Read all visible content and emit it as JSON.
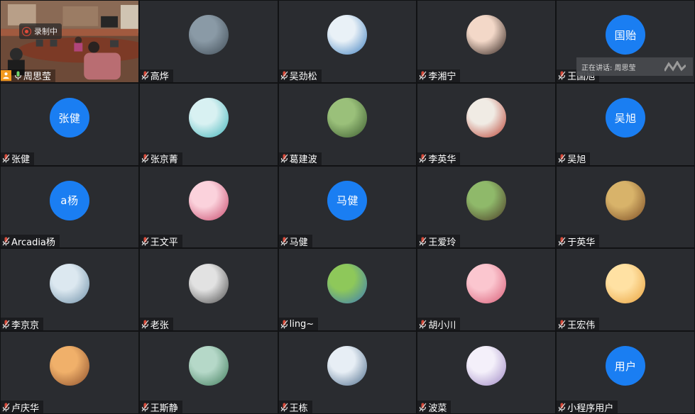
{
  "recording_label": "录制中",
  "speaking_banner": "正在讲话: 周思莹",
  "colors": {
    "accent": "#1a7ef2",
    "tile_bg": "#2a2c30",
    "mic": "#d64a3a",
    "host": "#f39a1e"
  },
  "participants": [
    {
      "name": "周思莹",
      "type": "video",
      "host": true
    },
    {
      "name": "高烨",
      "type": "photo",
      "icon": "foggy-figure-photo",
      "c1": "#8a9aa6",
      "c2": "#3f4b55"
    },
    {
      "name": "吴劲松",
      "type": "photo",
      "icon": "clouds-photo",
      "c1": "#e9f1f7",
      "c2": "#3d7fbf"
    },
    {
      "name": "李湘宁",
      "type": "photo",
      "icon": "portrait-photo",
      "c1": "#f3d8c8",
      "c2": "#2d1f1a"
    },
    {
      "name": "王国旭",
      "type": "text",
      "initials": "国贻"
    },
    {
      "name": "张健",
      "type": "text",
      "initials": "张健"
    },
    {
      "name": "张京菁",
      "type": "photo",
      "icon": "flower-photo",
      "c1": "#d8f1f2",
      "c2": "#3fb3b9"
    },
    {
      "name": "葛建波",
      "type": "photo",
      "icon": "garden-photo",
      "c1": "#9ac07a",
      "c2": "#3a5a2e"
    },
    {
      "name": "李英华",
      "type": "photo",
      "icon": "toys-photo",
      "c1": "#f0ebe4",
      "c2": "#b93e2f"
    },
    {
      "name": "吴旭",
      "type": "text",
      "initials": "吴旭"
    },
    {
      "name": "Arcadia杨",
      "type": "text",
      "initials": "a杨"
    },
    {
      "name": "王文平",
      "type": "photo",
      "icon": "blossom-photo",
      "c1": "#fbd2dc",
      "c2": "#c7466a"
    },
    {
      "name": "马健",
      "type": "text",
      "initials": "马健"
    },
    {
      "name": "王爱玲",
      "type": "photo",
      "icon": "tree-photo",
      "c1": "#8fb96a",
      "c2": "#4b3a26"
    },
    {
      "name": "于英华",
      "type": "photo",
      "icon": "cat-photo",
      "c1": "#d8b36a",
      "c2": "#7a4b23"
    },
    {
      "name": "李京京",
      "type": "photo",
      "icon": "ferris-wheel-photo",
      "c1": "#dce8f0",
      "c2": "#6c8ea6"
    },
    {
      "name": "老张",
      "type": "photo",
      "icon": "elder-portrait-photo",
      "c1": "#e2e2e2",
      "c2": "#4a4a4a"
    },
    {
      "name": "ling~",
      "type": "photo",
      "icon": "cartoon-house-photo",
      "c1": "#8ec85a",
      "c2": "#3a7ab9"
    },
    {
      "name": "胡小川",
      "type": "photo",
      "icon": "rose-photo",
      "c1": "#fbc6cf",
      "c2": "#d75a74"
    },
    {
      "name": "王宏伟",
      "type": "photo",
      "icon": "kitten-photo",
      "c1": "#ffe1a3",
      "c2": "#e8a03a"
    },
    {
      "name": "卢庆华",
      "type": "photo",
      "icon": "autumn-hills-photo",
      "c1": "#f0b06a",
      "c2": "#8a4d2a"
    },
    {
      "name": "王斯静",
      "type": "photo",
      "icon": "bamboo-photo",
      "c1": "#b5d8c8",
      "c2": "#3e7b5a"
    },
    {
      "name": "王栋",
      "type": "photo",
      "icon": "snow-mountain-photo",
      "c1": "#e7eef5",
      "c2": "#4a6a8a"
    },
    {
      "name": "波菜",
      "type": "photo",
      "icon": "anime-girl-photo",
      "c1": "#f4f0fa",
      "c2": "#9d86c4"
    },
    {
      "name": "小程序用户",
      "type": "text",
      "initials": "用户"
    }
  ]
}
